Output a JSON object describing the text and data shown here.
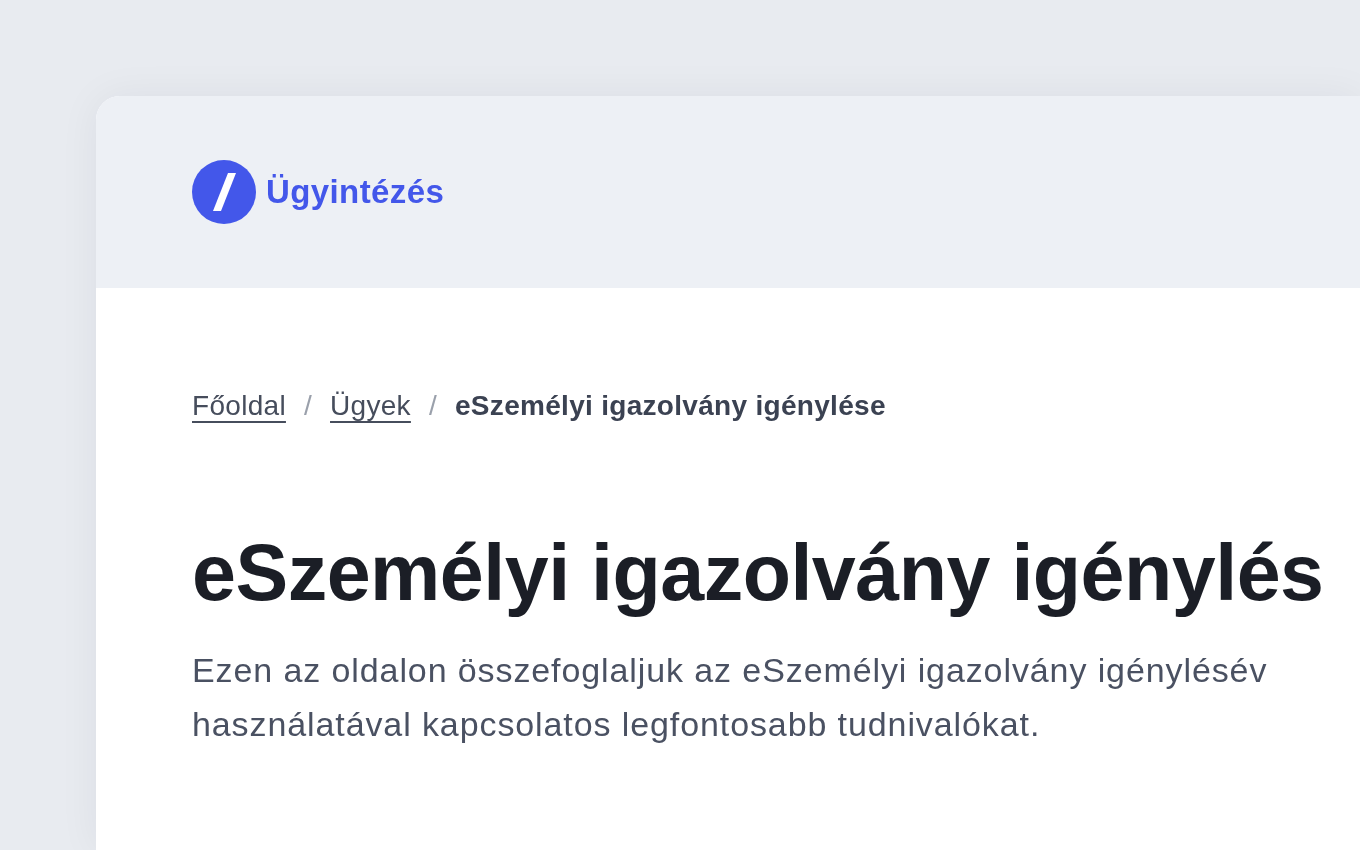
{
  "header": {
    "logo_text": "Ügyintézés"
  },
  "breadcrumb": [
    {
      "label": "Főoldal",
      "kind": "link",
      "separator": "/"
    },
    {
      "label": "Ügyek",
      "kind": "link",
      "separator": "/"
    },
    {
      "label": "eSzemélyi igazolvány igénylése",
      "kind": "current"
    }
  ],
  "title": "eSzemélyi igazolvány igénylés",
  "intro": {
    "lines": [
      "Ezen az oldalon összefoglaljuk az eSzemélyi igazolvány igénylésév",
      "használatával kapcsolatos legfontosabb tudnivalókat."
    ]
  }
}
